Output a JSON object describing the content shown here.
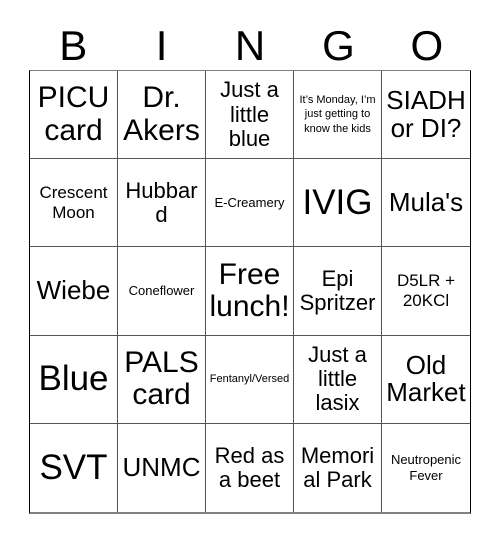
{
  "card": {
    "header_letters": [
      "B",
      "I",
      "N",
      "G",
      "O"
    ],
    "columns": 5,
    "rows": 5,
    "free_space_index": 12,
    "colors": {
      "background": "#ffffff",
      "text": "#000000",
      "grid_line": "#555555",
      "grid_outer": "#808080"
    },
    "cells": [
      {
        "text": "PICU card",
        "size": "xl"
      },
      {
        "text": "Dr. Akers",
        "size": "xl"
      },
      {
        "text": "Just a little blue",
        "size": "md"
      },
      {
        "text": "It’s Monday, I’m just getting to know the kids",
        "size": "xxs"
      },
      {
        "text": "SIADH or DI?",
        "size": "lg"
      },
      {
        "text": "Crescent Moon",
        "size": "sm"
      },
      {
        "text": "Hubbard",
        "size": "md"
      },
      {
        "text": "E-Creamery",
        "size": "xs"
      },
      {
        "text": "IVIG",
        "size": "xxl"
      },
      {
        "text": "Mula's",
        "size": "lg"
      },
      {
        "text": "Wiebe",
        "size": "lg"
      },
      {
        "text": "Coneflower",
        "size": "xs"
      },
      {
        "text": "Free lunch!",
        "size": "xl"
      },
      {
        "text": "Epi Spritzer",
        "size": "md"
      },
      {
        "text": "D5LR + 20KCl",
        "size": "sm"
      },
      {
        "text": "Blue",
        "size": "xxl"
      },
      {
        "text": "PALS card",
        "size": "xl"
      },
      {
        "text": "Fentanyl/Versed",
        "size": "xxs"
      },
      {
        "text": "Just a little lasix",
        "size": "md"
      },
      {
        "text": "Old Market",
        "size": "lg"
      },
      {
        "text": "SVT",
        "size": "xxl"
      },
      {
        "text": "UNMC",
        "size": "lg"
      },
      {
        "text": "Red as a beet",
        "size": "md"
      },
      {
        "text": "Memorial Park",
        "size": "md"
      },
      {
        "text": "Neutropenic Fever",
        "size": "xs"
      }
    ]
  }
}
